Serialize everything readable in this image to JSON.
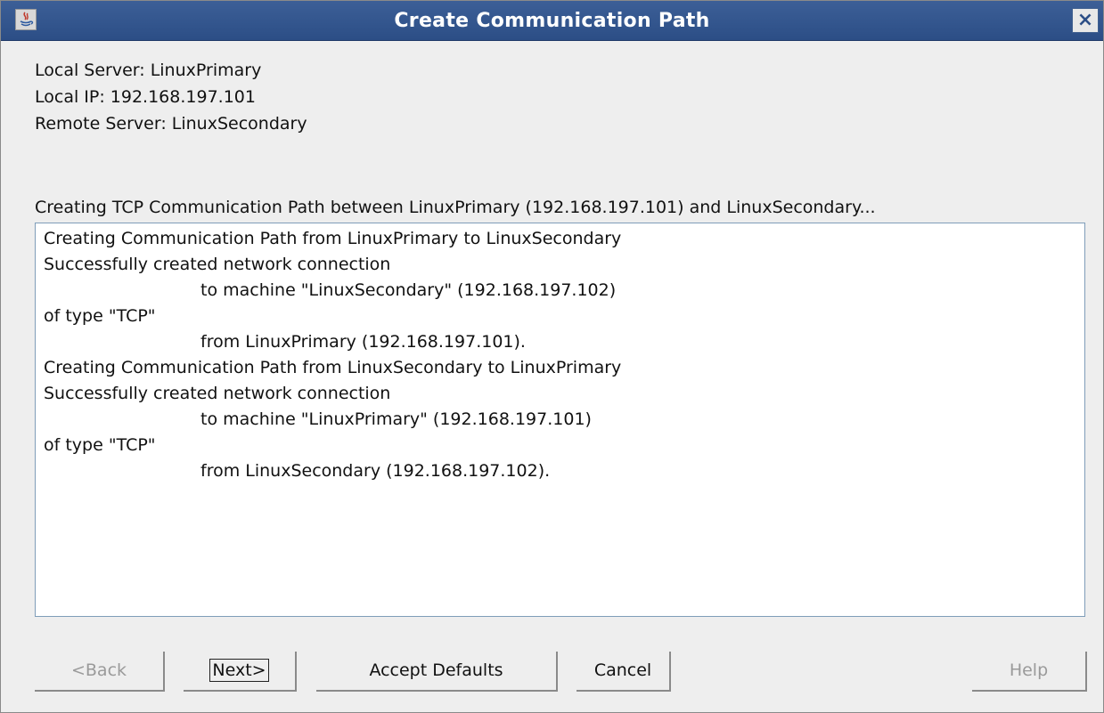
{
  "window": {
    "title": "Create Communication Path",
    "close_label": "×",
    "app_icon": "java-icon"
  },
  "info": {
    "local_server": "Local Server: LinuxPrimary",
    "local_ip": "Local IP: 192.168.197.101",
    "remote_server": "Remote Server: LinuxSecondary",
    "status": "Creating TCP Communication Path between LinuxPrimary (192.168.197.101) and LinuxSecondary..."
  },
  "log": {
    "lines": [
      "Creating Communication Path from LinuxPrimary to LinuxSecondary",
      "Successfully created network connection",
      "to machine \"LinuxSecondary\" (192.168.197.102)",
      "of type \"TCP\"",
      "from LinuxPrimary (192.168.197.101).",
      "Creating Communication Path from LinuxSecondary to LinuxPrimary",
      "Successfully created network connection",
      "to machine \"LinuxPrimary\" (192.168.197.101)",
      "of type \"TCP\"",
      "from LinuxSecondary (192.168.197.102)."
    ]
  },
  "buttons": {
    "back": "<Back",
    "next": "Next>",
    "accept_defaults": "Accept Defaults",
    "cancel": "Cancel",
    "help": "Help"
  },
  "colors": {
    "titlebar": "#2c4e86",
    "background": "#eeeeee",
    "disabled_text": "#9a9a9a"
  }
}
